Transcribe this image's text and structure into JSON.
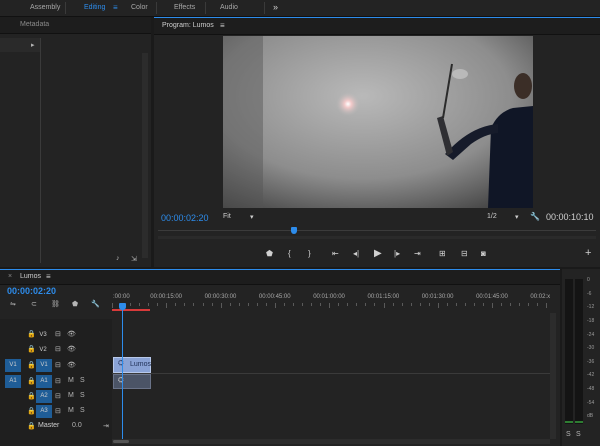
{
  "workspaces": {
    "items": [
      "Assembly",
      "Editing",
      "Color",
      "Effects",
      "Audio"
    ],
    "active_menu_icon": "menu-icon",
    "overflow": "»"
  },
  "source_panel": {
    "tab": "Metadata"
  },
  "program": {
    "title": "Program: Lumos",
    "menu": "≡",
    "timecode": "00:00:02:20",
    "fit": "Fit",
    "resolution": "1/2",
    "duration": "00:00:10:10",
    "playhead_fraction": 0.31
  },
  "timeline": {
    "sequence_name": "Lumos",
    "timecode": "00:00:02:20",
    "ruler": [
      ":00:00",
      "00:00:15:00",
      "00:00:30:00",
      "00:00:45:00",
      "00:01:00:00",
      "00:01:15:00",
      "00:01:30:00",
      "00:01:45:00",
      "00:02:x"
    ],
    "tracks": {
      "v3": "V3",
      "v2": "V2",
      "v1": "V1",
      "v1_source": "V1",
      "a1": "A1",
      "a1_source": "A1",
      "a2": "A2",
      "a3": "A3",
      "master": "Master",
      "master_value": "0.0"
    },
    "track_buttons": {
      "m": "M",
      "s": "S"
    },
    "clip_label": "Lumos"
  },
  "audio_meter": {
    "scale": [
      "0",
      "-6",
      "-12",
      "-18",
      "-24",
      "-30",
      "-36",
      "-42",
      "-48",
      "-54",
      "dB"
    ],
    "solo": [
      "S",
      "S"
    ]
  },
  "colors": {
    "accent": "#2d8ceb",
    "video_clip": "#8aa3d6",
    "playhead": "#2d8ceb",
    "work_bar": "#d83a3a"
  }
}
